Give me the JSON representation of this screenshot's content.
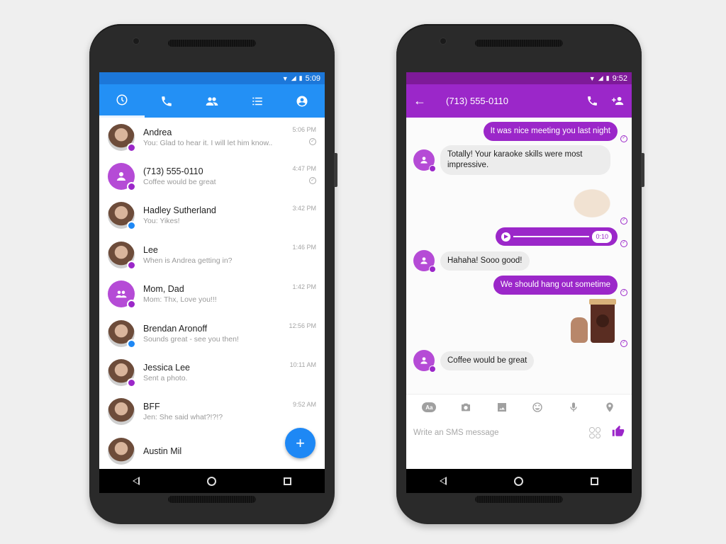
{
  "colors": {
    "messenger_blue": "#2390f5",
    "sms_purple": "#9b27c9",
    "background": "#efefef"
  },
  "left_phone": {
    "status_bar": {
      "time": "5:09",
      "icons": [
        "wifi-icon",
        "signal-icon",
        "battery-icon"
      ]
    },
    "tabs": [
      {
        "name": "recent",
        "icon": "clock-icon",
        "active": true
      },
      {
        "name": "calls",
        "icon": "phone-icon",
        "active": false
      },
      {
        "name": "groups",
        "icon": "people-icon",
        "active": false
      },
      {
        "name": "people",
        "icon": "list-icon",
        "active": false
      },
      {
        "name": "profile",
        "icon": "account-icon",
        "active": false
      }
    ],
    "conversations": [
      {
        "name": "Andrea",
        "snippet": "You: Glad to hear it. I will let him know..",
        "time": "5:06 PM",
        "avatar": "photo",
        "badge": "sms",
        "seen": true
      },
      {
        "name": "(713) 555-0110",
        "snippet": "Coffee would be great",
        "time": "4:47 PM",
        "avatar": "default-person",
        "badge": "sms",
        "seen": true
      },
      {
        "name": "Hadley Sutherland",
        "snippet": "You: Yikes!",
        "time": "3:42 PM",
        "avatar": "photo",
        "badge": "messenger",
        "seen": false
      },
      {
        "name": "Lee",
        "snippet": "When is Andrea getting in?",
        "time": "1:46 PM",
        "avatar": "photo",
        "badge": "sms",
        "seen": false
      },
      {
        "name": "Mom, Dad",
        "snippet": "Mom: Thx, Love you!!!",
        "time": "1:42 PM",
        "avatar": "default-group",
        "badge": "sms",
        "seen": false
      },
      {
        "name": "Brendan Aronoff",
        "snippet": "Sounds great - see you then!",
        "time": "12:56 PM",
        "avatar": "photo",
        "badge": "messenger",
        "seen": false
      },
      {
        "name": "Jessica Lee",
        "snippet": "Sent a photo.",
        "time": "10:11 AM",
        "avatar": "photo",
        "badge": "sms",
        "seen": false
      },
      {
        "name": "BFF",
        "snippet": "Jen: She said what?!?!?",
        "time": "9:52 AM",
        "avatar": "photo",
        "badge": "none",
        "seen": false
      },
      {
        "name": "Austin Mil",
        "snippet": "",
        "time": "",
        "avatar": "photo",
        "badge": "none",
        "seen": false
      }
    ],
    "fab_label": "+"
  },
  "right_phone": {
    "status_bar": {
      "time": "9:52",
      "icons": [
        "wifi-icon",
        "signal-icon",
        "battery-icon"
      ]
    },
    "header": {
      "back_icon": "←",
      "title": "(713) 555-0110"
    },
    "messages": [
      {
        "dir": "out",
        "type": "text",
        "text": "It was nice meeting you last night"
      },
      {
        "dir": "in",
        "type": "text",
        "text": "Totally! Your karaoke skills were most impressive."
      },
      {
        "dir": "out",
        "type": "sticker",
        "sticker": "karaoke-dog"
      },
      {
        "dir": "out",
        "type": "audio",
        "duration": "0:10"
      },
      {
        "dir": "in",
        "type": "text",
        "text": "Hahaha! Sooo good!"
      },
      {
        "dir": "out",
        "type": "text",
        "text": "We should hang out sometime"
      },
      {
        "dir": "out",
        "type": "sticker",
        "sticker": "coffee-cat"
      },
      {
        "dir": "in",
        "type": "text",
        "text": "Coffee would be great"
      }
    ],
    "composer": {
      "tools": [
        "text-style-icon",
        "camera-icon",
        "image-icon",
        "emoji-icon",
        "microphone-icon",
        "location-icon"
      ],
      "aa_label": "Aa",
      "placeholder": "Write an SMS message"
    }
  }
}
